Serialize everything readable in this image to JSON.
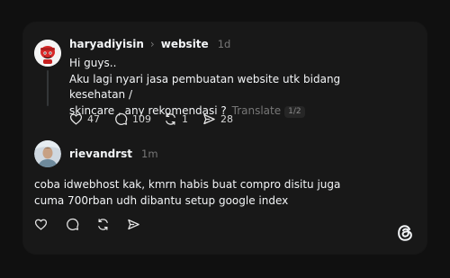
{
  "post": {
    "username": "haryadiyisin",
    "topic": "website",
    "time": "1d",
    "text_lines": [
      "Hi guys..",
      "Aku lagi nyari jasa pembuatan website utk bidang kesehatan /",
      "skincare , any rekomendasi ?"
    ],
    "translate_label": "Translate",
    "page_indicator": "1/2",
    "likes": "47",
    "comments": "109",
    "reposts": "1",
    "shares": "28"
  },
  "reply": {
    "username": "rievandrst",
    "time": "1m",
    "text_lines": [
      "coba idwebhost kak, kmrn habis buat compro disitu juga",
      "cuma 700rban udh dibantu setup google index"
    ]
  },
  "icons": {
    "like": "heart-icon",
    "comment": "comment-icon",
    "repost": "repost-icon",
    "share": "share-icon",
    "brand": "threads-logo"
  },
  "colors": {
    "background": "#101010",
    "card": "#181818",
    "text": "#f3f5f7",
    "muted": "#777777"
  }
}
